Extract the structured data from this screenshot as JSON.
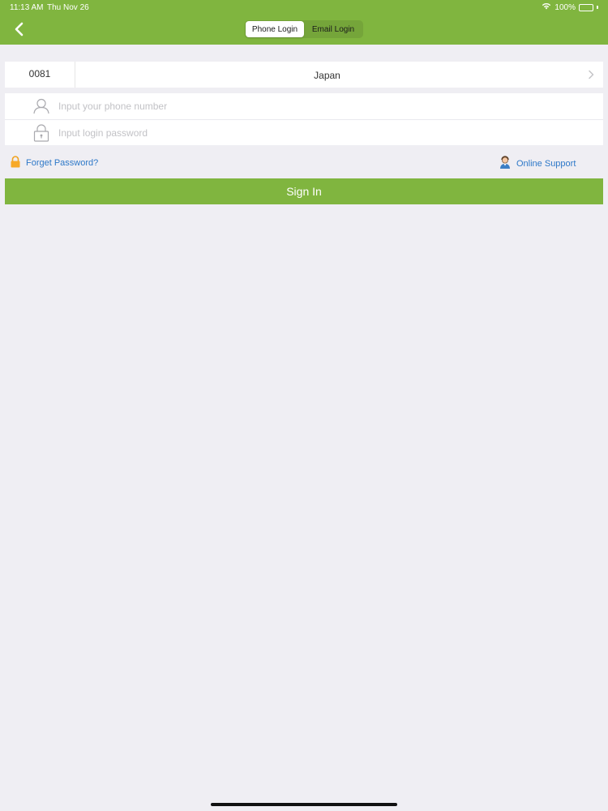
{
  "status_bar": {
    "time": "11:13 AM",
    "date": "Thu Nov 26",
    "battery": "100%"
  },
  "nav": {
    "tabs": [
      {
        "label": "Phone Login",
        "active": true
      },
      {
        "label": "Email Login",
        "active": false
      }
    ]
  },
  "country": {
    "code": "0081",
    "name": "Japan"
  },
  "inputs": {
    "phone_placeholder": "Input your phone number",
    "password_placeholder": "Input login password"
  },
  "links": {
    "forget_password": "Forget Password?",
    "online_support": "Online Support"
  },
  "signin_label": "Sign In",
  "colors": {
    "brand_green": "#80b53f",
    "link_blue": "#2d78c8",
    "background": "#efeef3"
  },
  "icons": {
    "back": "chevron-left-icon",
    "wifi": "wifi-icon",
    "battery": "battery-icon",
    "user": "user-icon",
    "lock": "lock-icon",
    "orange_lock": "padlock-icon",
    "support": "support-agent-icon",
    "chevron": "chevron-right-icon"
  }
}
